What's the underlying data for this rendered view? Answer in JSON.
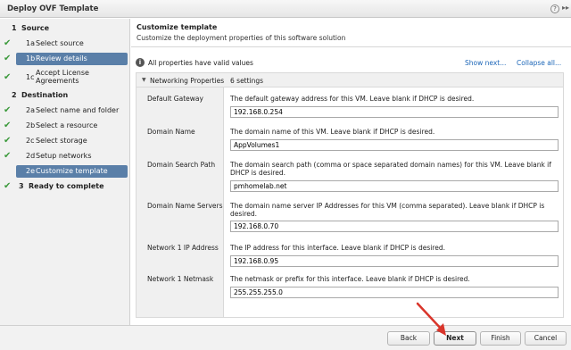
{
  "window": {
    "title": "Deploy OVF Template",
    "help_icon": "?",
    "expand_icon": "▸▸"
  },
  "sidebar": {
    "items": [
      {
        "num": "1",
        "label": "Source",
        "section": true,
        "done": false
      },
      {
        "num": "1a",
        "label": "Select source",
        "done": true
      },
      {
        "num": "1b",
        "label": "Review details",
        "done": true,
        "active": true
      },
      {
        "num": "1c",
        "label": "Accept License Agreements",
        "done": true
      },
      {
        "num": "2",
        "label": "Destination",
        "section": true,
        "done": false
      },
      {
        "num": "2a",
        "label": "Select name and folder",
        "done": true
      },
      {
        "num": "2b",
        "label": "Select a resource",
        "done": true
      },
      {
        "num": "2c",
        "label": "Select storage",
        "done": true
      },
      {
        "num": "2d",
        "label": "Setup networks",
        "done": true
      },
      {
        "num": "2e",
        "label": "Customize template",
        "done": false,
        "active": true
      },
      {
        "num": "3",
        "label": "Ready to complete",
        "section": true,
        "done": true
      }
    ]
  },
  "main": {
    "heading": "Customize template",
    "subheading": "Customize the deployment properties of this software solution",
    "status": "All properties have valid values",
    "show_next": "Show next...",
    "collapse_all": "Collapse all...",
    "group": {
      "name": "Networking Properties",
      "count": "6 settings"
    },
    "rows": [
      {
        "label": "Default Gateway",
        "desc": "The default gateway address for this VM. Leave blank if DHCP is desired.",
        "value": "192.168.0.254"
      },
      {
        "label": "Domain Name",
        "desc": "The domain name of this VM. Leave blank if DHCP is desired.",
        "value": "AppVolumes1"
      },
      {
        "label": "Domain Search Path",
        "desc": "The domain search path (comma or space separated domain names) for this VM. Leave blank if DHCP is desired.",
        "value": "pmhomelab.net"
      },
      {
        "label": "Domain Name Servers",
        "desc": "The domain name server IP Addresses for this VM (comma separated). Leave blank if DHCP is desired.",
        "value": "192.168.0.70"
      },
      {
        "label": "Network 1 IP Address",
        "desc": "The IP address for this interface. Leave blank if DHCP is desired.",
        "value": "192.168.0.95"
      },
      {
        "label": "Network 1 Netmask",
        "desc": "The netmask or prefix for this interface. Leave blank if DHCP is desired.",
        "value": "255.255.255.0"
      }
    ]
  },
  "footer": {
    "back": "Back",
    "next": "Next",
    "finish": "Finish",
    "cancel": "Cancel"
  },
  "colors": {
    "accent": "#5a7fa8",
    "check": "#3c9a3c",
    "link": "#1c66b8",
    "arrow": "#d9352b"
  }
}
